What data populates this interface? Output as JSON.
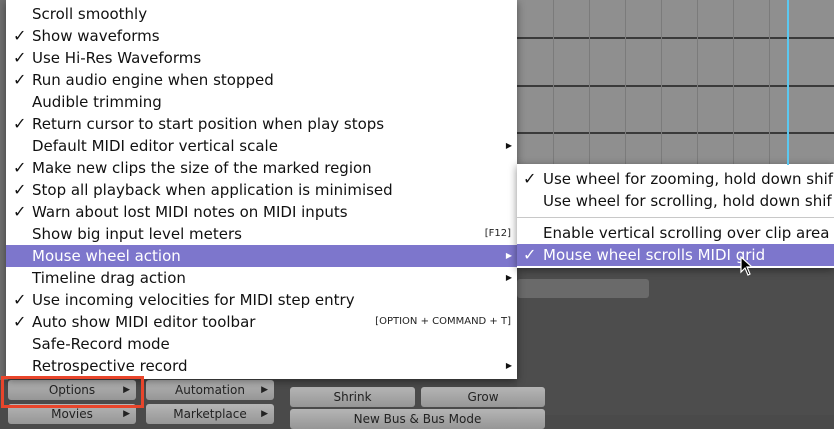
{
  "menu": {
    "items": [
      {
        "label": "Scroll smoothly",
        "checked": false,
        "shortcut": "",
        "submenu": false,
        "active": false
      },
      {
        "label": "Show waveforms",
        "checked": true,
        "shortcut": "",
        "submenu": false,
        "active": false
      },
      {
        "label": "Use Hi-Res Waveforms",
        "checked": true,
        "shortcut": "",
        "submenu": false,
        "active": false
      },
      {
        "label": "Run audio engine when stopped",
        "checked": true,
        "shortcut": "",
        "submenu": false,
        "active": false
      },
      {
        "label": "Audible trimming",
        "checked": false,
        "shortcut": "",
        "submenu": false,
        "active": false
      },
      {
        "label": "Return cursor to start position when play stops",
        "checked": true,
        "shortcut": "",
        "submenu": false,
        "active": false
      },
      {
        "label": "Default MIDI editor vertical scale",
        "checked": false,
        "shortcut": "",
        "submenu": true,
        "active": false
      },
      {
        "label": "Make new clips the size of the marked region",
        "checked": true,
        "shortcut": "",
        "submenu": false,
        "active": false
      },
      {
        "label": "Stop all playback when application is minimised",
        "checked": true,
        "shortcut": "",
        "submenu": false,
        "active": false
      },
      {
        "label": "Warn about lost MIDI notes on MIDI inputs",
        "checked": true,
        "shortcut": "",
        "submenu": false,
        "active": false
      },
      {
        "label": "Show big input level meters",
        "checked": false,
        "shortcut": "[F12]",
        "submenu": false,
        "active": false
      },
      {
        "label": "Mouse wheel action",
        "checked": false,
        "shortcut": "",
        "submenu": true,
        "active": true
      },
      {
        "label": "Timeline drag action",
        "checked": false,
        "shortcut": "",
        "submenu": true,
        "active": false
      },
      {
        "label": "Use incoming velocities for MIDI step entry",
        "checked": true,
        "shortcut": "",
        "submenu": false,
        "active": false
      },
      {
        "label": "Auto show MIDI editor toolbar",
        "checked": true,
        "shortcut": "[OPTION + COMMAND + T]",
        "submenu": false,
        "active": false
      },
      {
        "label": "Safe-Record mode",
        "checked": false,
        "shortcut": "",
        "submenu": false,
        "active": false
      },
      {
        "label": "Retrospective record",
        "checked": false,
        "shortcut": "",
        "submenu": true,
        "active": false
      }
    ]
  },
  "submenu": {
    "group1": [
      {
        "label": "Use wheel for zooming, hold down shif",
        "checked": true
      },
      {
        "label": "Use wheel for scrolling, hold down shif",
        "checked": false
      }
    ],
    "group2": [
      {
        "label": "Enable vertical scrolling over clip area",
        "checked": false,
        "active": false
      },
      {
        "label": "Mouse wheel scrolls MIDI grid",
        "checked": true,
        "active": true
      }
    ]
  },
  "check_glyph": "✓",
  "arrow_glyph": "▶",
  "buttons": {
    "options": "Options",
    "automation": "Automation",
    "shrink": "Shrink",
    "grow": "Grow",
    "movies": "Movies",
    "marketplace": "Marketplace",
    "partial_bottom": "New Bus & Bus Mode"
  },
  "colors": {
    "highlight": "#7d76cc",
    "playhead": "#5bc8f0",
    "callout_border": "#e8452b"
  }
}
